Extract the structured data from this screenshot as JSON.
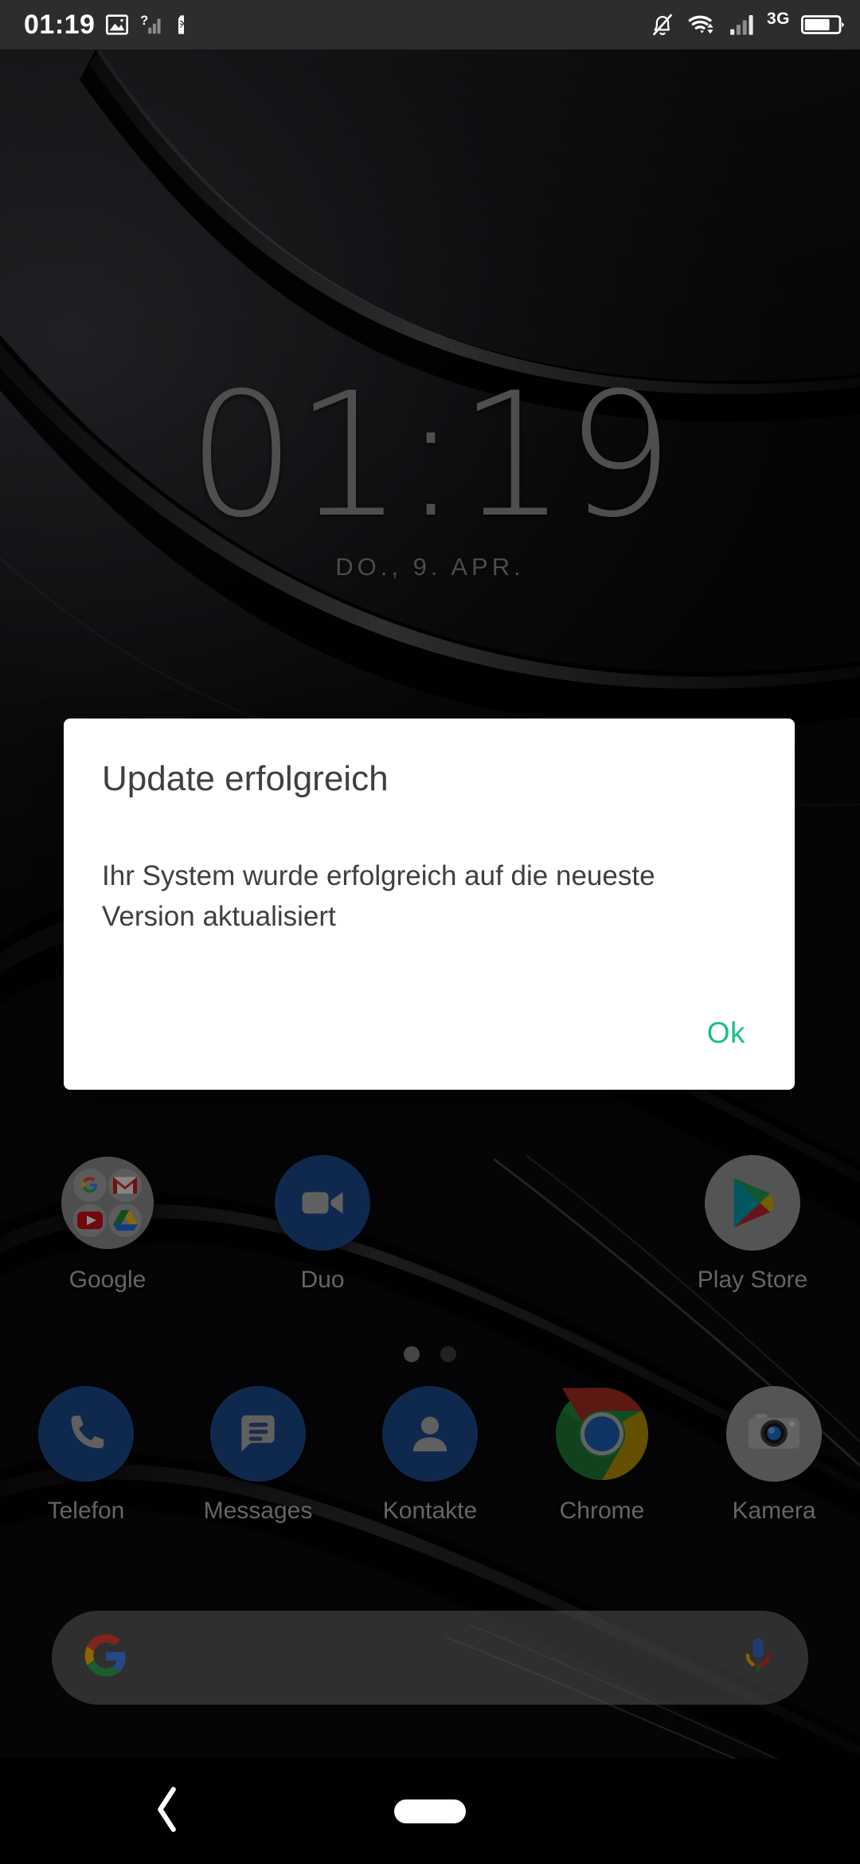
{
  "status_bar": {
    "clock": "01:19",
    "left_icons": [
      "image-icon",
      "unknown-network-signal-icon",
      "nfc-tag-icon"
    ],
    "right_icons": [
      "silent-bell-icon",
      "wifi-icon",
      "cellular-signal-icon",
      "network-type-label",
      "battery-icon"
    ],
    "network_type": "3G",
    "background_color": "#2d2d2d"
  },
  "clock_widget": {
    "time": "01:19",
    "date": "DO., 9. APR."
  },
  "dialog": {
    "title": "Update erfolgreich",
    "message": "Ihr System wurde erfolgreich auf die neueste Version aktualisiert",
    "ok_label": "Ok",
    "ok_color": "#1bbd8c",
    "background_color": "#ffffff",
    "text_color": "#3c4043"
  },
  "home_screen": {
    "top_row": [
      {
        "label": "Google",
        "icon": "google-folder-icon"
      },
      {
        "label": "Duo",
        "icon": "duo-icon"
      },
      {
        "label": "",
        "icon": "empty-slot"
      },
      {
        "label": "Play Store",
        "icon": "play-store-icon"
      }
    ],
    "dock_row": [
      {
        "label": "Telefon",
        "icon": "phone-icon"
      },
      {
        "label": "Messages",
        "icon": "messages-icon"
      },
      {
        "label": "Kontakte",
        "icon": "contacts-icon"
      },
      {
        "label": "Chrome",
        "icon": "chrome-icon"
      },
      {
        "label": "Kamera",
        "icon": "camera-icon"
      }
    ],
    "page_indicator": {
      "total": 2,
      "active_index": 0
    }
  },
  "search_bar": {
    "value": "",
    "placeholder": "",
    "left_icon": "google-g-icon",
    "right_icon": "microphone-icon"
  },
  "nav_bar": {
    "back_icon": "back-chevron-icon",
    "home_icon": "home-pill-icon",
    "background_color": "#000000"
  }
}
